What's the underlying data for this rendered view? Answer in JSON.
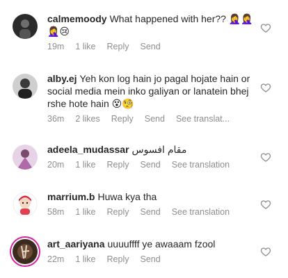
{
  "comments": [
    {
      "username": "calmemoody",
      "text": "What happened with her??",
      "emoji": "🤦‍♀️🤦‍♀️🤦‍♀️😢",
      "time": "19m",
      "likes": "1 like",
      "reply": "Reply",
      "send": "Send",
      "translate": ""
    },
    {
      "username": "alby.ej",
      "text": "Yeh kon log hain jo pagal hojate hain or social media mein inko galiyan or lanatein bhej rshe hote hain",
      "emoji": "😵🧐",
      "time": "36m",
      "likes": "2 likes",
      "reply": "Reply",
      "send": "Send",
      "translate": "See translat..."
    },
    {
      "username": "adeela_mudassar",
      "text": "مقام افسوس",
      "emoji": "",
      "time": "20m",
      "likes": "1 like",
      "reply": "Reply",
      "send": "Send",
      "translate": "See translation"
    },
    {
      "username": "marrium.b",
      "text": "Huwa kya tha",
      "emoji": "",
      "time": "58m",
      "likes": "1 like",
      "reply": "Reply",
      "send": "Send",
      "translate": "See translation"
    },
    {
      "username": "art_aariyana",
      "text": "uuuuffff ye awaaam fzool",
      "emoji": "",
      "time": "22m",
      "likes": "1 like",
      "reply": "Reply",
      "send": "Send",
      "translate": ""
    }
  ]
}
